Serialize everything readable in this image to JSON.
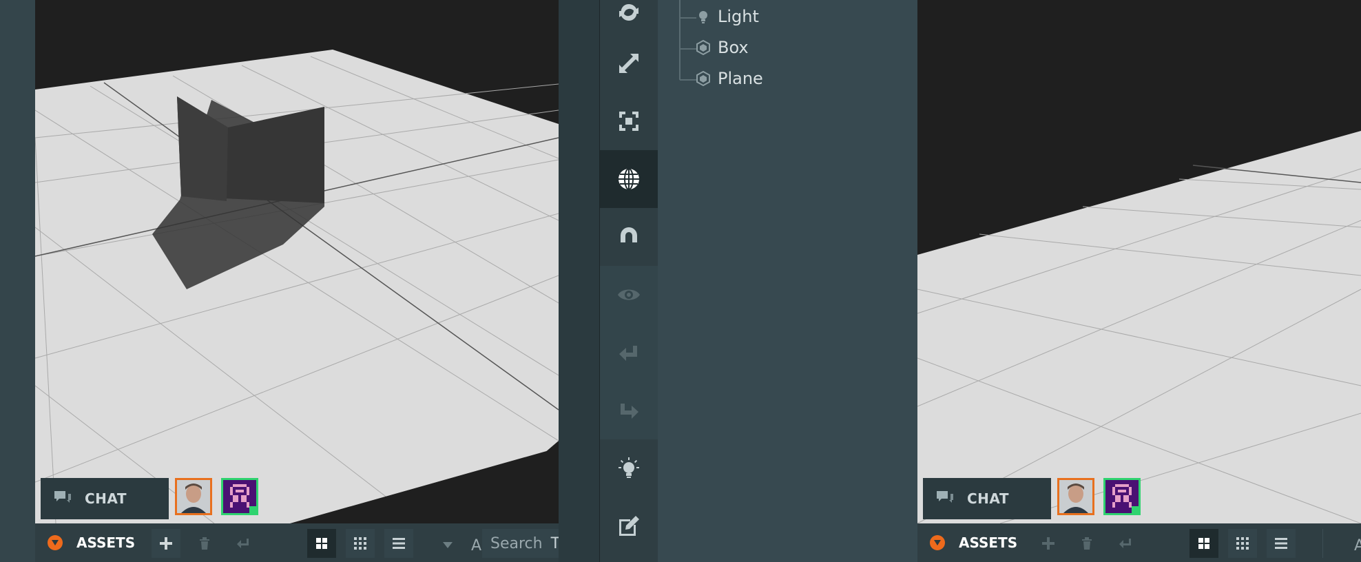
{
  "hierarchy": {
    "items": [
      {
        "label": "Light",
        "icon": "light-bulb-icon"
      },
      {
        "label": "Box",
        "icon": "entity-icon"
      },
      {
        "label": "Plane",
        "icon": "entity-icon"
      }
    ]
  },
  "toolbar": {
    "tools": [
      {
        "name": "rotate-tool",
        "icon": "rotate-icon"
      },
      {
        "name": "scale-tool",
        "icon": "resize-icon"
      },
      {
        "name": "frame-selection-tool",
        "icon": "focus-icon"
      },
      {
        "name": "world-space-toggle",
        "icon": "globe-icon",
        "active": true
      },
      {
        "name": "snap-toggle",
        "icon": "magnet-icon"
      },
      {
        "name": "preview-button",
        "icon": "eye-icon"
      },
      {
        "name": "undo-button",
        "icon": "undo-icon"
      },
      {
        "name": "redo-button",
        "icon": "redo-icon"
      },
      {
        "name": "lightmapper-button",
        "icon": "lightbulb-icon"
      },
      {
        "name": "code-editor-button",
        "icon": "edit-icon"
      }
    ]
  },
  "left_panel": {
    "chat_label": "CHAT",
    "assets_label": "ASSETS",
    "search_placeholder": "Search",
    "search_overflow_text": "A",
    "search_right_text": "T"
  },
  "right_panel": {
    "chat_label": "CHAT",
    "assets_label": "ASSETS",
    "overflow_text": "A"
  },
  "colors": {
    "accent_orange": "#ee6a1c",
    "online_green": "#2fd36f",
    "panel_dark": "#2f3e43",
    "viewport_bg": "#1f1f1f",
    "floor": "#dcdcdc"
  }
}
